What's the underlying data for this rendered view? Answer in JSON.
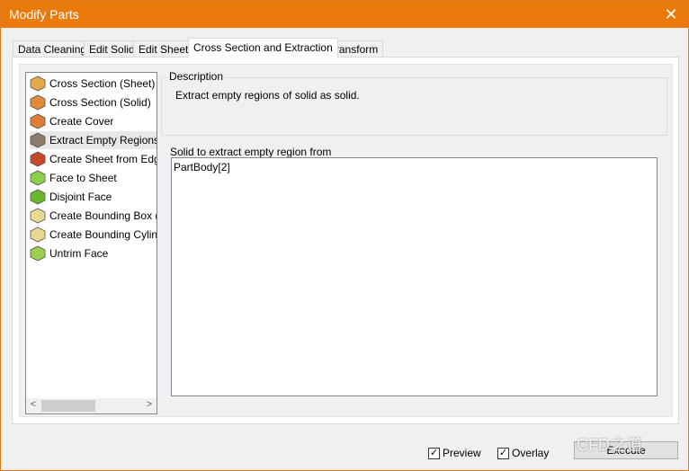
{
  "window": {
    "title": "Modify Parts",
    "close_icon": "close-icon"
  },
  "tabs": [
    {
      "label": "Data Cleaning"
    },
    {
      "label": "Edit Solid"
    },
    {
      "label": "Edit Sheet"
    },
    {
      "label": "Cross Section and Extraction",
      "active": true
    },
    {
      "label": "Transform"
    }
  ],
  "operations": [
    {
      "label": "Cross Section (Sheet)",
      "icon": "cross-section-sheet-icon",
      "color": "#e7a84a"
    },
    {
      "label": "Cross Section (Solid)",
      "icon": "cross-section-solid-icon",
      "color": "#e08a3a"
    },
    {
      "label": "Create Cover",
      "icon": "create-cover-icon",
      "color": "#e07b38"
    },
    {
      "label": "Extract Empty Regions of Solid",
      "icon": "extract-empty-regions-icon",
      "color": "#8a7a6a",
      "selected": true
    },
    {
      "label": "Create Sheet from Edges",
      "icon": "sheet-from-edges-icon",
      "color": "#c8482a"
    },
    {
      "label": "Face to Sheet",
      "icon": "face-to-sheet-icon",
      "color": "#8ad04a"
    },
    {
      "label": "Disjoint Face",
      "icon": "disjoint-face-icon",
      "color": "#6ab82a"
    },
    {
      "label": "Create Bounding Box (Axis Aligned)",
      "icon": "bounding-box-icon",
      "color": "#e8d890"
    },
    {
      "label": "Create Bounding Cylinder",
      "icon": "bounding-cylinder-icon",
      "color": "#e8d890"
    },
    {
      "label": "Untrim Face",
      "icon": "untrim-face-icon",
      "color": "#9ad04a"
    }
  ],
  "description": {
    "title": "Description",
    "text": "Extract empty regions of solid as solid."
  },
  "input": {
    "label": "Solid to extract empty region from",
    "value": "PartBody[2]"
  },
  "footer": {
    "preview": {
      "label": "Preview",
      "checked": true
    },
    "overlay": {
      "label": "Overlay",
      "checked": true
    },
    "execute": "Execute"
  },
  "watermark": "CFD之道"
}
